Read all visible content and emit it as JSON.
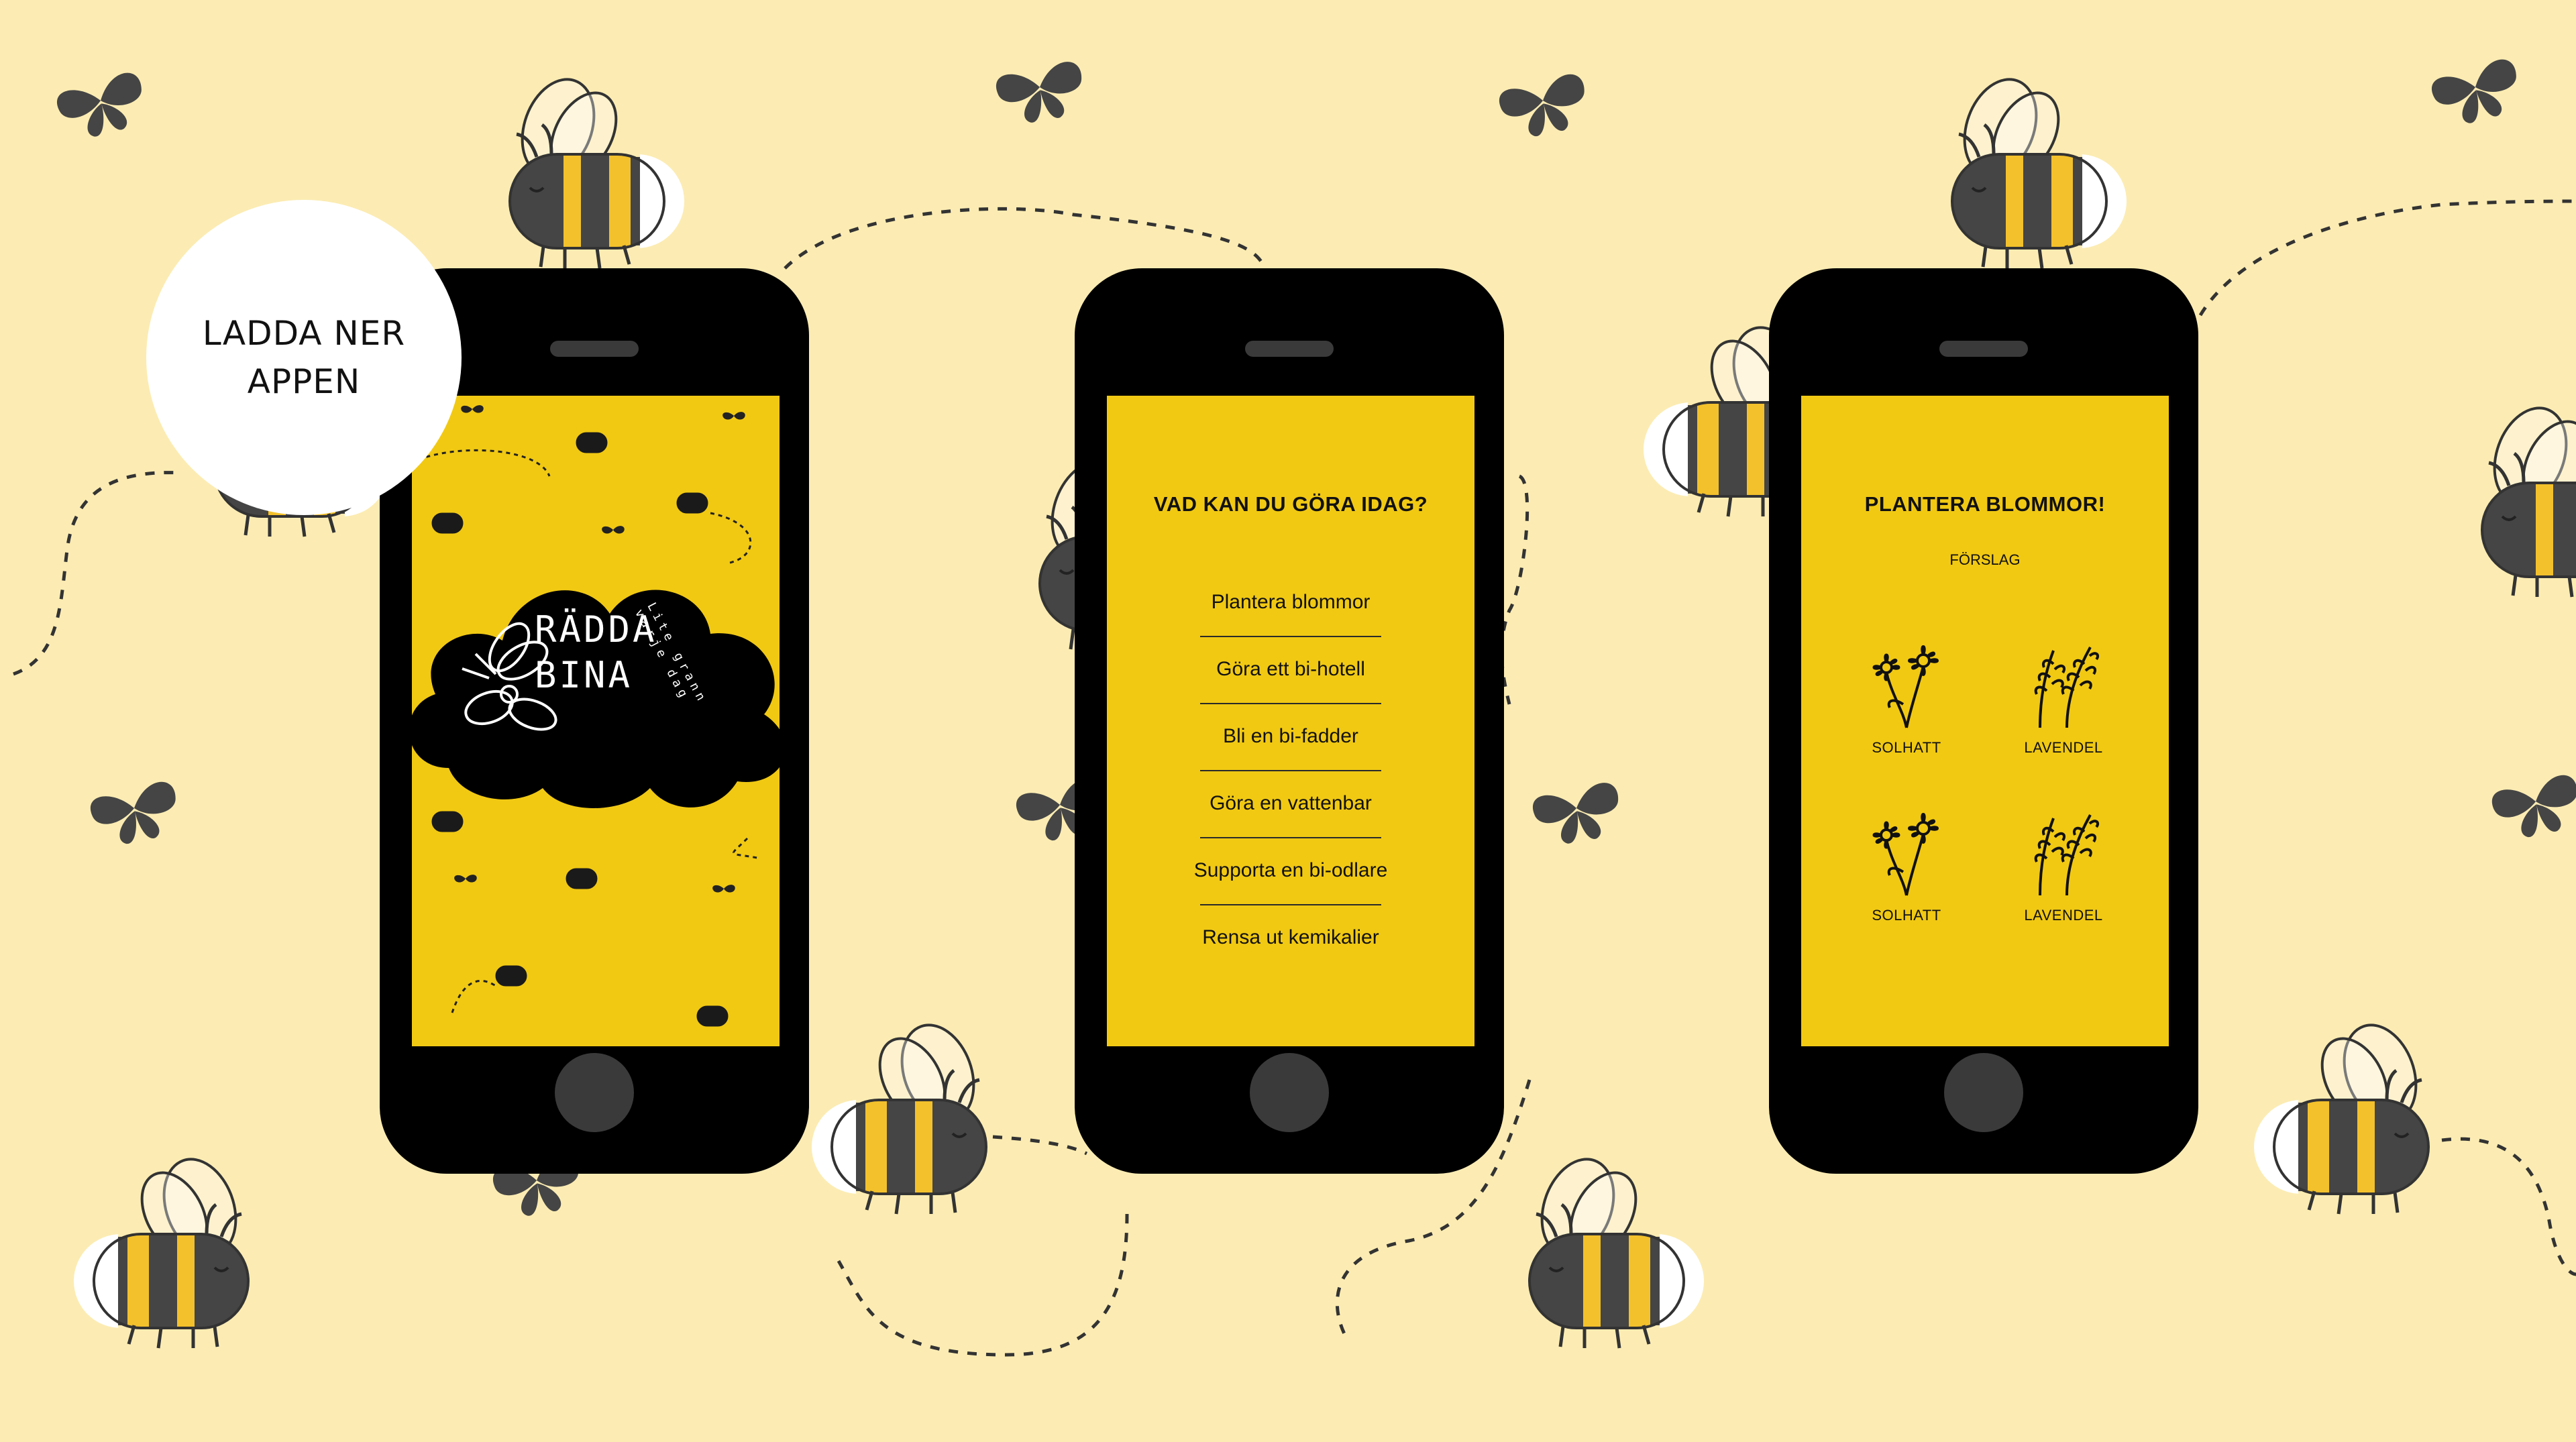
{
  "badge": {
    "line1": "LADDA NER",
    "line2": "APPEN"
  },
  "phone1": {
    "logo_line1": "RÄDDA",
    "logo_line2": "BINA",
    "tagline": "Lite grann varje dag"
  },
  "phone2": {
    "title": "VAD KAN DU GÖRA IDAG?",
    "items": [
      "Plantera blommor",
      "Göra ett bi-hotell",
      "Bli en bi-fadder",
      "Göra en vattenbar",
      "Supporta en bi-odlare",
      "Rensa ut kemikalier"
    ]
  },
  "phone3": {
    "title": "PLANTERA BLOMMOR!",
    "subtitle": "FÖRSLAG",
    "flowers": [
      "SOLHATT",
      "LAVENDEL",
      "SOLHATT",
      "LAVENDEL"
    ]
  },
  "colors": {
    "background": "#fcecb3",
    "screen": "#f1c913",
    "phone": "#000000",
    "bee_stripe": "#454545",
    "bee_yellow": "#f3c12b"
  },
  "icons": [
    "bee-icon",
    "butterfly-icon",
    "flower-daisy-icon",
    "flower-lavender-icon"
  ]
}
